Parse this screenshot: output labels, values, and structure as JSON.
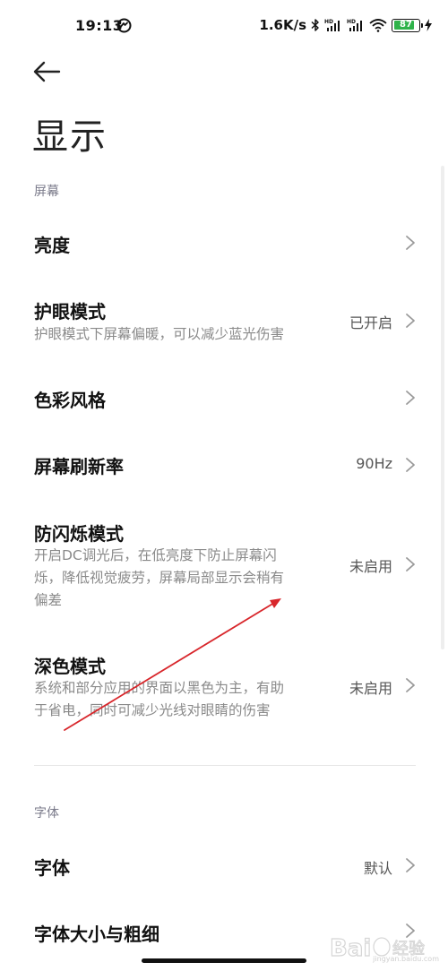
{
  "status_bar": {
    "time": "19:13",
    "net_speed": "1.6K/s",
    "battery_level": "87",
    "battery_fraction": 0.87,
    "battery_color": "#2fb34a",
    "icons": [
      "app-notification-icon",
      "bluetooth-icon",
      "hd-signal-icon",
      "hd-signal-icon",
      "wifi-icon",
      "battery-icon",
      "charging-icon"
    ]
  },
  "page": {
    "title": "显示"
  },
  "sections": {
    "screen": {
      "header": "屏幕",
      "items": [
        {
          "title": "亮度",
          "desc": "",
          "value": ""
        },
        {
          "title": "护眼模式",
          "desc": "护眼模式下屏幕偏暖，可以减少蓝光伤害",
          "value": "已开启"
        },
        {
          "title": "色彩风格",
          "desc": "",
          "value": ""
        },
        {
          "title": "屏幕刷新率",
          "desc": "",
          "value": "90Hz"
        },
        {
          "title": "防闪烁模式",
          "desc_lines": [
            "开启DC调光后，在低亮度下防止屏幕闪",
            "烁，降低视觉疲劳，屏幕局部显示会稍有",
            "偏差"
          ],
          "value": "未启用"
        },
        {
          "title": "深色模式",
          "desc_lines": [
            "系统和部分应用的界面以黑色为主，有助",
            "于省电，同时可减少光线对眼睛的伤害"
          ],
          "value": "未启用"
        }
      ]
    },
    "font": {
      "header": "字体",
      "items": [
        {
          "title": "字体",
          "value": "默认"
        },
        {
          "title": "字体大小与粗细",
          "value": ""
        }
      ]
    }
  },
  "annotation": {
    "color": "#d8262b"
  },
  "watermark": {
    "text": "jingyan.baidu.com"
  }
}
